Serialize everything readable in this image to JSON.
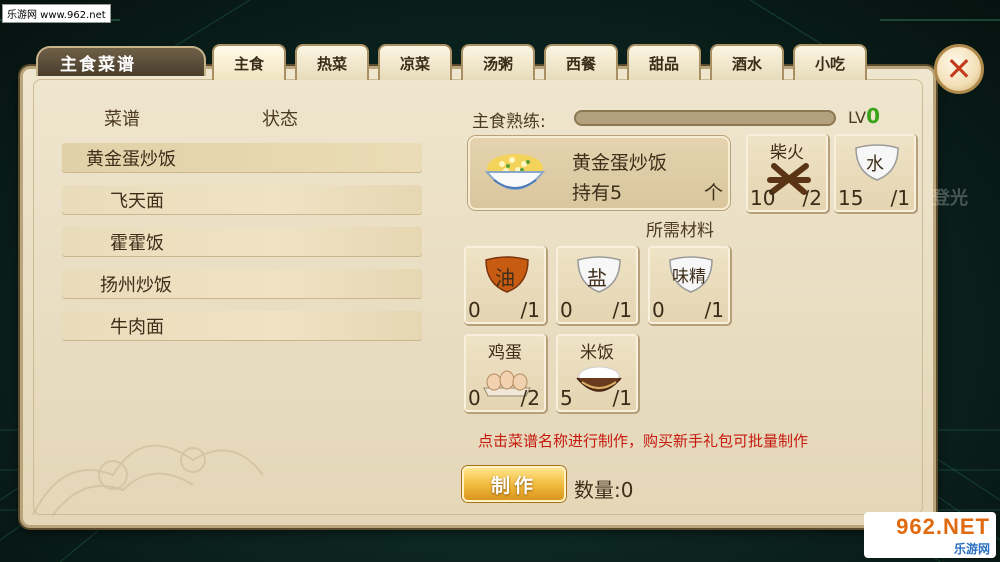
{
  "watermark": {
    "top_left": "乐游网 www.962.net",
    "brand": "962.NET",
    "brand_sub": "乐游网"
  },
  "panel": {
    "title": "主食菜谱"
  },
  "tabs": [
    {
      "label": "主食",
      "active": true
    },
    {
      "label": "热菜"
    },
    {
      "label": "凉菜"
    },
    {
      "label": "汤粥"
    },
    {
      "label": "西餐"
    },
    {
      "label": "甜品"
    },
    {
      "label": "酒水"
    },
    {
      "label": "小吃"
    }
  ],
  "side_deco_text": "登光",
  "list": {
    "col_recipe": "菜谱",
    "col_status": "状态",
    "items": [
      "黄金蛋炒饭",
      "飞天面",
      "霍霍饭",
      "扬州炒饭",
      "牛肉面"
    ]
  },
  "mastery": {
    "label": "主食熟练:",
    "progress": 0,
    "lv_label": "LV",
    "lv_value": "0"
  },
  "dish": {
    "name": "黄金蛋炒饭",
    "hold_label": "持有5",
    "unit": "个"
  },
  "fuel": [
    {
      "name": "柴火",
      "have": "10",
      "need": "/2",
      "icon": "firewood-icon"
    },
    {
      "name": "水",
      "have": "15",
      "need": "/1",
      "icon": "water-bowl-icon"
    }
  ],
  "required_label": "所需材料",
  "materials": [
    {
      "name": "油",
      "have": "0",
      "need": "/1",
      "icon": "oil-icon",
      "color": "#c75b12"
    },
    {
      "name": "盐",
      "have": "0",
      "need": "/1",
      "icon": "salt-bowl-icon"
    },
    {
      "name": "味精",
      "have": "0",
      "need": "/1",
      "icon": "msg-bowl-icon"
    },
    {
      "name": "鸡蛋",
      "have": "0",
      "need": "/2",
      "icon": "eggs-icon"
    },
    {
      "name": "米饭",
      "have": "5",
      "need": "/1",
      "icon": "rice-bowl-icon"
    }
  ],
  "notice": "点击菜谱名称进行制作，购买新手礼包可批量制作",
  "make_button": "制作",
  "quantity": "数量:0"
}
